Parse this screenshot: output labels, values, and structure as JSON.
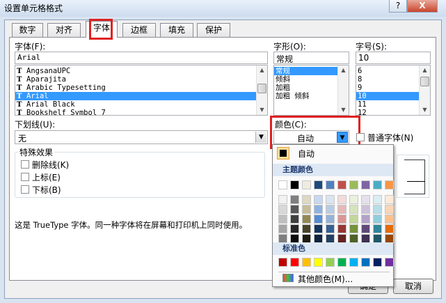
{
  "window": {
    "title": "设置单元格格式",
    "help_label": "?",
    "close_label": "X"
  },
  "tabs": [
    "数字",
    "对齐",
    "字体",
    "边框",
    "填充",
    "保护"
  ],
  "font": {
    "label": "字体(F):",
    "value": "Arial",
    "items": [
      "AngsanaUPC",
      "Aparajita",
      "Arabic Typesetting",
      "Arial",
      "Arial Black",
      "Bookshelf Symbol 7"
    ],
    "selected_index": 3
  },
  "style": {
    "label": "字形(O):",
    "value": "常规",
    "items": [
      "常规",
      "倾斜",
      "加粗",
      "加粗 倾斜"
    ],
    "selected_index": 0
  },
  "size": {
    "label": "字号(S):",
    "value": "10",
    "items": [
      "6",
      "8",
      "9",
      "10",
      "11",
      "12"
    ],
    "selected_index": 3
  },
  "underline": {
    "label": "下划线(U):",
    "value": "无"
  },
  "color": {
    "label": "颜色(C):",
    "value": "自动",
    "normal_font_label": "普通字体(N)"
  },
  "effects": {
    "group_label": "特殊效果",
    "items": [
      "删除线(K)",
      "上标(E)",
      "下标(B)"
    ]
  },
  "description": "这是 TrueType 字体。同一种字体将在屏幕和打印机上同时使用。",
  "color_popup": {
    "auto_label": "自动",
    "theme_header": "主题颜色",
    "standard_header": "标准色",
    "more_colors_label": "其他颜色(M)...",
    "theme_top_row": [
      "#ffffff",
      "#000000",
      "#eeece1",
      "#1f497d",
      "#4f81bd",
      "#c0504d",
      "#9bbb59",
      "#8064a2",
      "#4bacc6",
      "#f79646"
    ],
    "theme_shades": [
      [
        "#f2f2f2",
        "#d8d8d8",
        "#bfbfbf",
        "#a5a5a5",
        "#7f7f7f"
      ],
      [
        "#7f7f7f",
        "#595959",
        "#3f3f3f",
        "#262626",
        "#0c0c0c"
      ],
      [
        "#ddd9c3",
        "#c4bd97",
        "#938953",
        "#494429",
        "#1d1b10"
      ],
      [
        "#c6d9f0",
        "#8db3e2",
        "#548dd4",
        "#17365d",
        "#0f243e"
      ],
      [
        "#dbe5f1",
        "#b8cce4",
        "#95b3d7",
        "#366092",
        "#244061"
      ],
      [
        "#f2dcdb",
        "#e5b9b7",
        "#d99694",
        "#953734",
        "#632423"
      ],
      [
        "#ebf1dd",
        "#d7e3bc",
        "#c3d69b",
        "#76923c",
        "#4f6128"
      ],
      [
        "#e5e0ec",
        "#ccc1d9",
        "#b2a2c7",
        "#5f497a",
        "#3f3151"
      ],
      [
        "#dbeef3",
        "#b7dde8",
        "#92cddc",
        "#31859b",
        "#205867"
      ],
      [
        "#fdeada",
        "#fbd5b5",
        "#fac08f",
        "#e36c09",
        "#974806"
      ]
    ],
    "standard_row": [
      "#c00000",
      "#ff0000",
      "#ffc000",
      "#ffff00",
      "#92d050",
      "#00b050",
      "#00b0f0",
      "#0070c0",
      "#002060",
      "#7030a0"
    ]
  },
  "buttons": {
    "ok": "确定",
    "cancel": "取消"
  },
  "accent_color": "#3399ff",
  "highlight_color": "#e02020"
}
